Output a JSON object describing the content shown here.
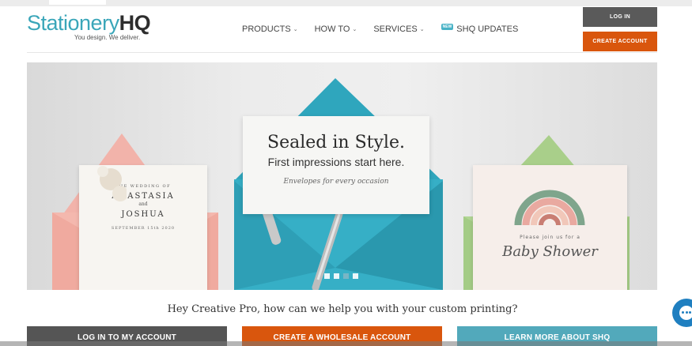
{
  "brand": {
    "name_part1": "Stationery",
    "name_part2": "HQ",
    "tagline": "You design. We deliver."
  },
  "nav": {
    "items": [
      {
        "label": "PRODUCTS",
        "has_dropdown": true
      },
      {
        "label": "HOW TO",
        "has_dropdown": true
      },
      {
        "label": "SERVICES",
        "has_dropdown": true
      },
      {
        "label": "SHQ UPDATES",
        "badge": "NEW"
      }
    ],
    "chevron": "⌄"
  },
  "header": {
    "login_label": "LOG IN",
    "create_account_label": "CREATE ACCOUNT"
  },
  "hero": {
    "headline": "Sealed in Style.",
    "subheadline": "First impressions start here.",
    "caption": "Envelopes for every occasion",
    "left_card": {
      "line1": "THE WEDDING OF",
      "name1": "ANASTASIA",
      "and": "and",
      "name2": "JOSHUA",
      "date": "SEPTEMBER 15th 2020"
    },
    "right_card": {
      "line1": "Please join us for a",
      "title": "Baby Shower"
    },
    "slides": 4,
    "active_slide": 3
  },
  "help_text": "Hey Creative Pro, how can we help you with your custom printing?",
  "cta": {
    "login_account": "LOG IN TO MY ACCOUNT",
    "wholesale": "CREATE A WHOLESALE ACCOUNT",
    "learn_more": "LEARN MORE ABOUT SHQ"
  },
  "colors": {
    "brand_teal": "#3aa6b9",
    "accent_orange": "#d9560d",
    "dark_gray": "#5a5a5a",
    "cta_teal": "#52a9bb",
    "chat_blue": "#1f7fc0"
  },
  "icons": {
    "chat": "chat-bubble-icon",
    "dropdown": "chevron-down-icon"
  }
}
